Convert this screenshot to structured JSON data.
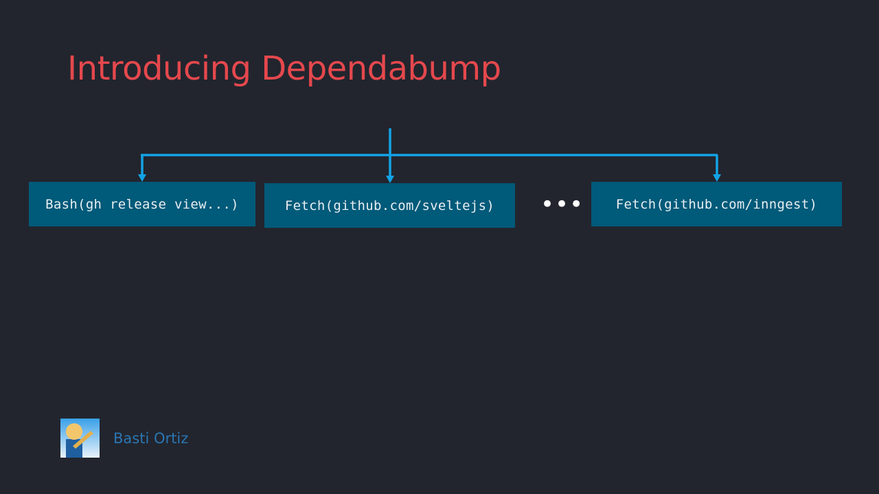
{
  "slide": {
    "title": "Introducing Dependabump",
    "boxes": [
      {
        "label": "Bash(gh release view...)"
      },
      {
        "label": "Fetch(github.com/sveltejs)"
      },
      {
        "label": "Fetch(github.com/inngest)"
      }
    ],
    "ellipsis": "•••",
    "author": "Basti Ortiz",
    "avatar_icon": "avatar-portrait-icon"
  },
  "colors": {
    "background": "#22252e",
    "title": "#e5484d",
    "box_fill": "#005a79",
    "box_text": "#e8eef2",
    "connector": "#12a3e6",
    "ellipsis": "#ffffff",
    "author": "#2b76b2"
  }
}
